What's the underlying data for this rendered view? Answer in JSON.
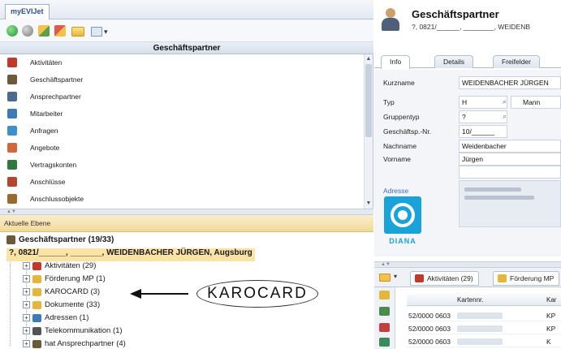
{
  "app": {
    "tab_label": "myEVIJet"
  },
  "toolbar": {
    "icons": [
      "green-forward-icon",
      "gray-stop-icon",
      "refresh-icon",
      "favorites-icon",
      "folder-icon",
      "view-menu-icon"
    ],
    "view_caret": "▾"
  },
  "nav": {
    "title": "Geschäftspartner",
    "items": [
      {
        "label": "Aktivitäten",
        "color": "#c0392b"
      },
      {
        "label": "Geschäftspartner",
        "color": "#6b5b3a"
      },
      {
        "label": "Ansprechpartner",
        "color": "#4a6b8f"
      },
      {
        "label": "Mitarbeiter",
        "color": "#3d7ab8"
      },
      {
        "label": "Anfragen",
        "color": "#3d8fcf"
      },
      {
        "label": "Angebote",
        "color": "#d4673a"
      },
      {
        "label": "Vertragskonten",
        "color": "#2f7a3a"
      },
      {
        "label": "Anschlüsse",
        "color": "#b5452f"
      },
      {
        "label": "Anschlussobjekte",
        "color": "#9a6b2a"
      }
    ]
  },
  "level": {
    "label": "Aktuelle Ebene"
  },
  "tree": {
    "root_label": "Geschäftspartner (19/33)",
    "selected_label": "?, 0821/______, _______, WEIDENBACHER JÜRGEN, Augsburg",
    "children": [
      {
        "label": "Aktivitäten (29)",
        "color": "#c0392b"
      },
      {
        "label": "Förderung MP (1)",
        "color": "#e6b63a"
      },
      {
        "label": "KAROCARD (3)",
        "color": "#e6b63a"
      },
      {
        "label": "Dokumente (33)",
        "color": "#e6b63a"
      },
      {
        "label": "Adressen (1)",
        "color": "#3d7ab8"
      },
      {
        "label": "Telekommunikation (1)",
        "color": "#555555"
      },
      {
        "label": "hat Ansprechpartner (4)",
        "color": "#6b5b3a"
      }
    ]
  },
  "annotation": {
    "label": "KAROCARD"
  },
  "detail": {
    "title": "Geschäftspartner",
    "subtitle": "?, 0821/______, ________, WEIDENB",
    "tabs": [
      "Info",
      "Details",
      "Freifelder"
    ],
    "fields": {
      "kurzname_label": "Kurzname",
      "kurzname_value": "WEIDENBACHER JÜRGEN",
      "typ_label": "Typ",
      "typ_value": "H",
      "typ_text": "Mann",
      "gruppentyp_label": "Gruppentyp",
      "gruppentyp_value": "?",
      "gpnr_label": "Geschäftsp.-Nr.",
      "gpnr_value": "10/______",
      "nachname_label": "Nachname",
      "nachname_value": "Weidenbacher",
      "vorname_label": "Vorname",
      "vorname_value": "Jürgen"
    },
    "adresse_label": "Adresse",
    "logo_text": "DIANA"
  },
  "bottom": {
    "tabs": [
      "Aktivitäten (29)",
      "Förderung MP"
    ],
    "columns": [
      "Kartennr.",
      "Kar"
    ],
    "rows": [
      {
        "nr": "52/0000 0603",
        "kar": "KP"
      },
      {
        "nr": "52/0000 0603",
        "kar": "KP"
      },
      {
        "nr": "52/0000 0603",
        "kar": "K"
      }
    ]
  }
}
